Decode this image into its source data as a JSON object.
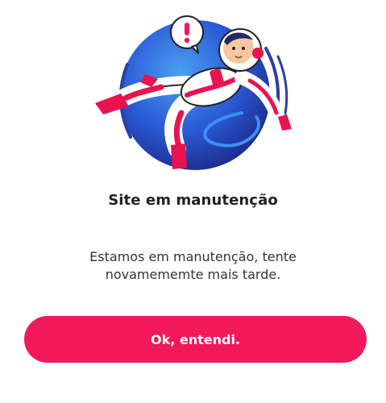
{
  "illustration": {
    "icon": "astronaut-floating-illustration",
    "alert_icon": "exclamation-speech-bubble-icon"
  },
  "dialog": {
    "title": "Site em manutenção",
    "message_line1": "Estamos em manutenção, tente",
    "message_line2": "novamememte mais tarde.",
    "ok_label": "Ok, entendi."
  },
  "colors": {
    "accent": "#f2195a",
    "planet_blue": "#2a5bd7",
    "planet_dark": "#1d2f8f",
    "text": "#222222"
  }
}
